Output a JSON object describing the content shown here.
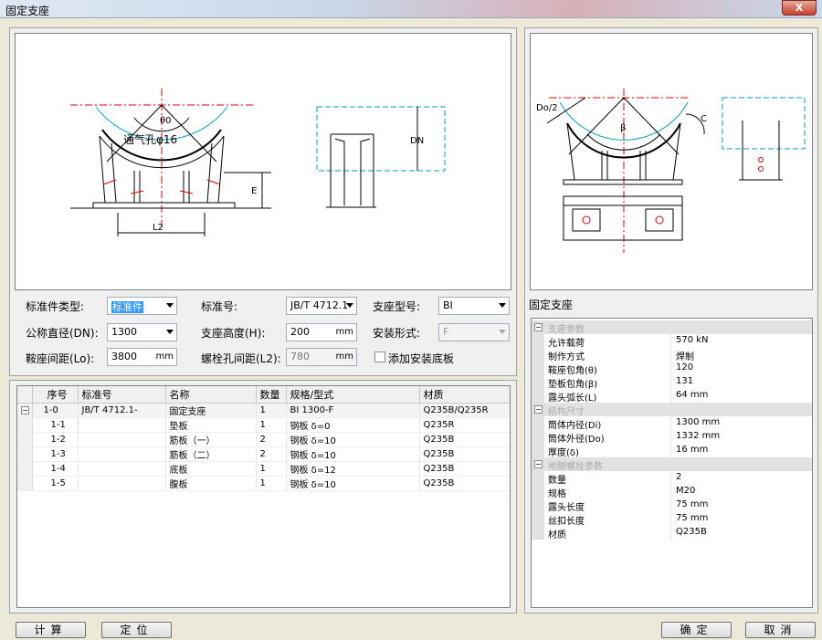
{
  "window": {
    "title": "固定支座",
    "close_label": "X"
  },
  "form": {
    "std_type": {
      "label": "标准件类型:",
      "value": "标准件"
    },
    "std_no": {
      "label": "标准号:",
      "value": "JB/T 4712.1"
    },
    "support_type": {
      "label": "支座型号:",
      "value": "BI"
    },
    "dn": {
      "label": "公称直径(DN):",
      "value": "1300"
    },
    "height": {
      "label": "支座高度(H):",
      "value": "200",
      "unit": "mm"
    },
    "install": {
      "label": "安装形式:",
      "value": "F"
    },
    "spacing": {
      "label": "鞍座间距(Lo):",
      "value": "3800",
      "unit": "mm"
    },
    "bolt_spacing": {
      "label": "螺栓孔间距(L2):",
      "value": "780",
      "unit": "mm"
    },
    "add_base": {
      "label": "添加安装底板",
      "checked": false
    }
  },
  "drawing_labels": {
    "vent": "通气孔φ16",
    "angle": "θ0",
    "dn": "DN",
    "e": "E",
    "l2": "L2",
    "do2": "Do/2",
    "beta": "β",
    "c": "C"
  },
  "table": {
    "headers": [
      "序号",
      "标准号",
      "名称",
      "数量",
      "规格/型式",
      "材质"
    ],
    "rows": [
      {
        "no": "1-0",
        "std": "JB/T 4712.1-",
        "name": "固定支座",
        "qty": "1",
        "spec": "BI 1300-F",
        "mat": "Q235B/Q235R",
        "parent": true
      },
      {
        "no": "1-1",
        "std": "",
        "name": "垫板",
        "qty": "1",
        "spec": "钢板 δ=0",
        "mat": "Q235R"
      },
      {
        "no": "1-2",
        "std": "",
        "name": "筋板（一）",
        "qty": "2",
        "spec": "钢板 δ=10",
        "mat": "Q235B"
      },
      {
        "no": "1-3",
        "std": "",
        "name": "筋板（二）",
        "qty": "2",
        "spec": "钢板 δ=10",
        "mat": "Q235B"
      },
      {
        "no": "1-4",
        "std": "",
        "name": "底板",
        "qty": "1",
        "spec": "钢板 δ=12",
        "mat": "Q235B"
      },
      {
        "no": "1-5",
        "std": "",
        "name": "腹板",
        "qty": "1",
        "spec": "钢板 δ=10",
        "mat": "Q235B"
      }
    ]
  },
  "properties": {
    "title": "固定支座",
    "groups": [
      {
        "name": "支座参数",
        "items": [
          [
            "允许载荷",
            "570 kN"
          ],
          [
            "制作方式",
            "焊制"
          ],
          [
            "鞍座包角(θ)",
            "120"
          ],
          [
            "垫板包角(β)",
            "131"
          ],
          [
            "露头弧长(L)",
            "64  mm"
          ]
        ]
      },
      {
        "name": "结构尺寸",
        "items": [
          [
            "筒体内径(Di)",
            "1300  mm"
          ],
          [
            "筒体外径(Do)",
            "1332  mm"
          ],
          [
            "厚度(δ)",
            "16  mm"
          ]
        ]
      },
      {
        "name": "地脚螺栓参数",
        "items": [
          [
            "数量",
            "2"
          ],
          [
            "规格",
            "M20"
          ],
          [
            "露头长度",
            "75  mm"
          ],
          [
            "丝扣长度",
            "75  mm"
          ],
          [
            "材质",
            "Q235B"
          ]
        ]
      }
    ]
  },
  "buttons": {
    "calc": "计算",
    "locate": "定位",
    "ok": "确定",
    "cancel": "取消"
  }
}
